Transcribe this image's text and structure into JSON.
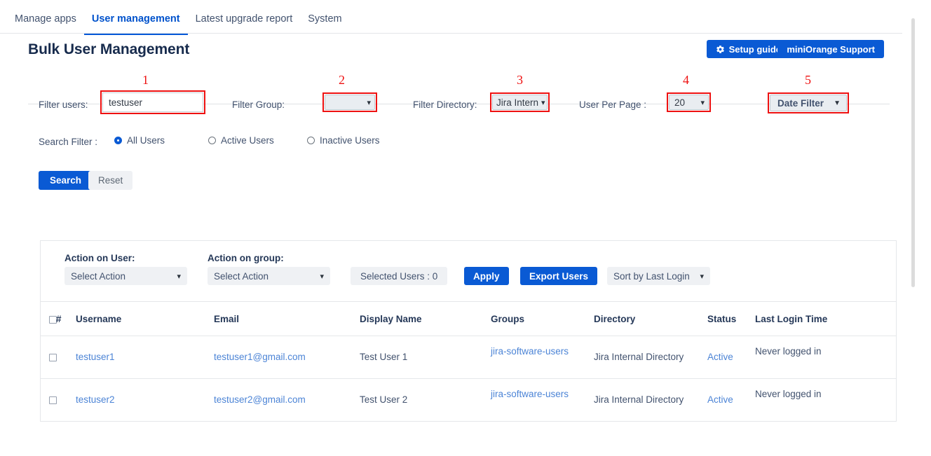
{
  "nav": {
    "tabs": [
      {
        "label": "Manage apps",
        "active": false
      },
      {
        "label": "User management",
        "active": true
      },
      {
        "label": "Latest upgrade report",
        "active": false
      },
      {
        "label": "System",
        "active": false
      }
    ]
  },
  "header": {
    "title": "Bulk User Management",
    "setup_guide_label": "Setup guide",
    "setup_guide_icon": "gear-icon",
    "support_label": "miniOrange Support"
  },
  "filters": {
    "annotations": [
      "1",
      "2",
      "3",
      "4",
      "5"
    ],
    "filter_users_label": "Filter users:",
    "filter_users_value": "testuser",
    "filter_group_label": "Filter Group:",
    "filter_group_value": "",
    "filter_directory_label": "Filter Directory:",
    "filter_directory_value": "Jira Intern",
    "user_per_page_label": "User Per Page :",
    "user_per_page_value": "20",
    "date_filter_value": "Date Filter",
    "search_filter_label": "Search Filter :",
    "radios": [
      {
        "label": "All Users",
        "checked": true
      },
      {
        "label": "Active Users",
        "checked": false
      },
      {
        "label": "Inactive Users",
        "checked": false
      }
    ],
    "search_button": "Search",
    "reset_button": "Reset"
  },
  "action_bar": {
    "action_on_user_label": "Action on User:",
    "action_on_user_value": "Select Action",
    "action_on_group_label": "Action on group:",
    "action_on_group_value": "Select Action",
    "selected_users_chip": "Selected Users : 0",
    "apply_button": "Apply",
    "export_button": "Export Users",
    "sort_value": "Sort by Last Login"
  },
  "table": {
    "columns": [
      "#",
      "Username",
      "Email",
      "Display Name",
      "Groups",
      "Directory",
      "Status",
      "Last Login Time"
    ],
    "rows": [
      {
        "username": "testuser1",
        "email": "testuser1@gmail.com",
        "display_name": "Test User 1",
        "groups": "jira-software-users",
        "directory": "Jira Internal Directory",
        "status": "Active",
        "last_login": "Never logged in"
      },
      {
        "username": "testuser2",
        "email": "testuser2@gmail.com",
        "display_name": "Test User 2",
        "groups": "jira-software-users",
        "directory": "Jira Internal Directory",
        "status": "Active",
        "last_login": "Never logged in"
      }
    ]
  },
  "colors": {
    "primary_blue": "#0a5ad4",
    "link_blue": "#4c84d6",
    "annotation_red": "#ee1111",
    "heading_navy": "#172b4d"
  }
}
